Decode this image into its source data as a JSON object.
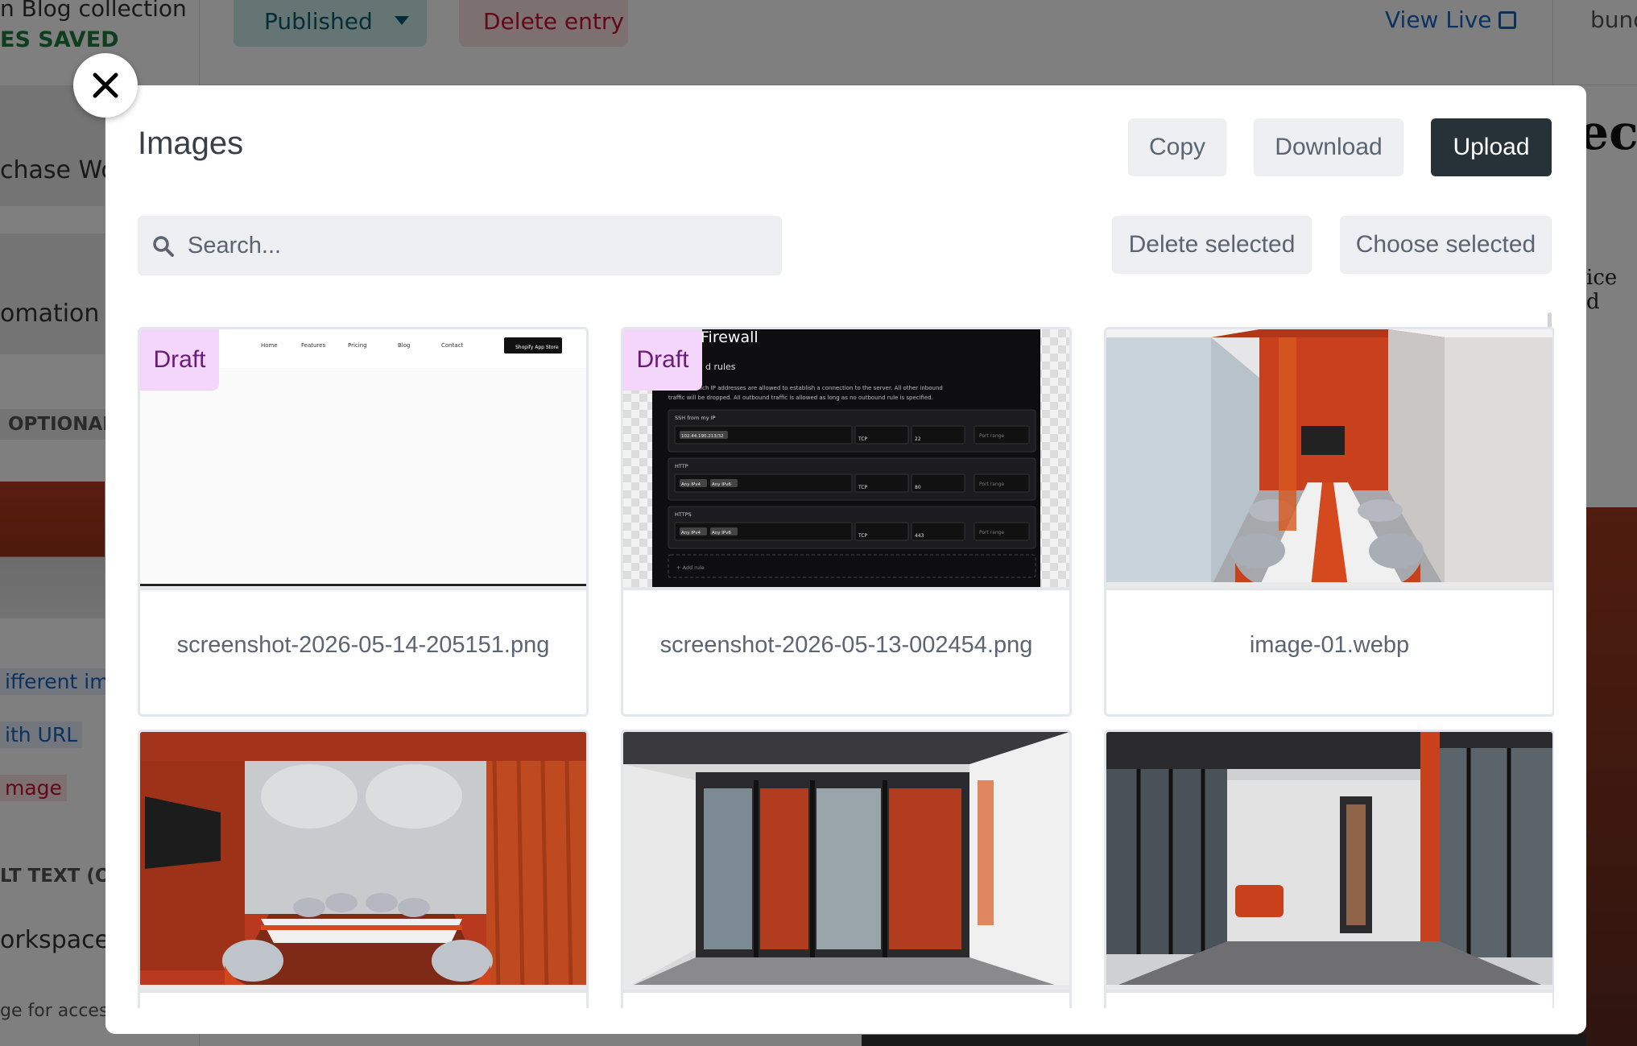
{
  "background": {
    "collection_text": "n Blog collection",
    "saved_status": "ES SAVED",
    "status_select": "Published",
    "delete_entry": "Delete entry",
    "view_live": "View Live",
    "bundle_text": "bund",
    "sidebar_purchase": "chase Work",
    "sidebar_automation": "omation",
    "optional_label": "OPTIONAL)",
    "different_image": "ifferent imag",
    "with_url": "ith URL",
    "image_link": "mage",
    "alt_text_label": "LT TEXT (OP",
    "workspace_value": "orkspace",
    "access_hint": "ge for access",
    "right_heading": "ect",
    "right_text": "ice d"
  },
  "modal": {
    "title": "Images",
    "copy_label": "Copy",
    "download_label": "Download",
    "upload_label": "Upload",
    "search_placeholder": "Search...",
    "delete_selected_label": "Delete selected",
    "choose_selected_label": "Choose selected",
    "draft_badge": "Draft"
  },
  "thumb_text": {
    "nav_home": "Home",
    "nav_features": "Features",
    "nav_pricing": "Pricing",
    "nav_blog": "Blog",
    "nav_contact": "Contact",
    "app_store_button": "Shopify App Store",
    "firewall_title": "Firewall",
    "firewall_subtitle": "d rules",
    "firewall_desc_line1": "s define which IP addresses are allowed to establish a connection to the server. All other inbound",
    "firewall_desc_line2": "traffic will be dropped. All outbound traffic is allowed as long as no outbound rule is specified.",
    "rule1_name": "SSH from my IP",
    "rule1_ip": "102.44.190.213/32",
    "rule1_protocol": "TCP",
    "rule1_port": "22",
    "rule2_name": "HTTP",
    "rule2_ipv4": "Any IPv4",
    "rule2_ipv6": "Any IPv6",
    "rule2_protocol": "TCP",
    "rule2_port": "80",
    "rule3_name": "HTTPS",
    "rule3_ipv4": "Any IPv4",
    "rule3_ipv6": "Any IPv6",
    "rule3_protocol": "TCP",
    "rule3_port": "443",
    "port_range_placeholder": "Port range",
    "add_rule": "+ Add rule"
  },
  "images": [
    {
      "filename": "screenshot-2026-05-14-205151.png",
      "draft": true
    },
    {
      "filename": "screenshot-2026-05-13-002454.png",
      "draft": true
    },
    {
      "filename": "image-01.webp",
      "draft": false
    },
    {
      "filename": "",
      "draft": false
    },
    {
      "filename": "",
      "draft": false
    },
    {
      "filename": "",
      "draft": false
    }
  ],
  "colors": {
    "upload_bg": "#263238",
    "draft_badge_bg": "#f3d6fa",
    "accent_orange": "#c9401c"
  }
}
